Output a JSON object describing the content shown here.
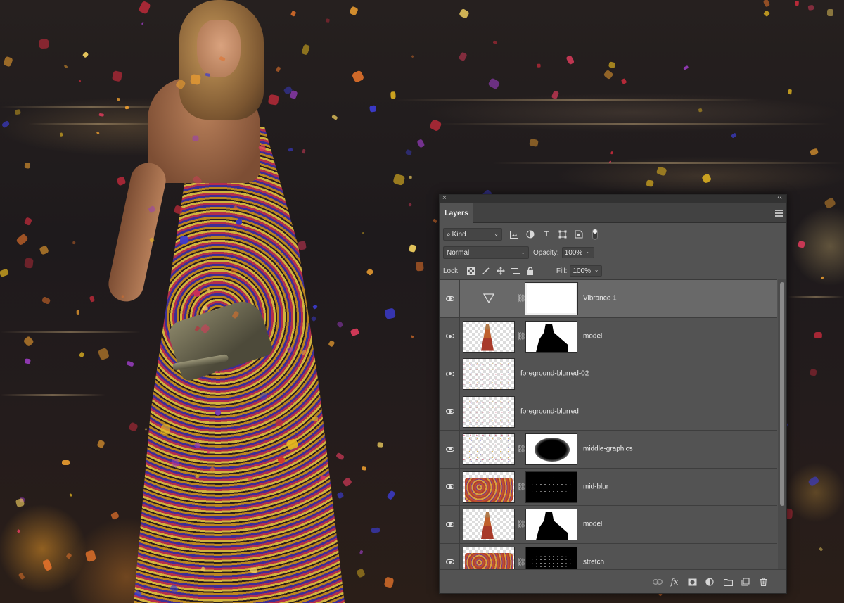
{
  "panel": {
    "close_glyph": "×",
    "collapse_glyph": "‹‹",
    "tab_label": "Layers",
    "filter": {
      "kind_label": "Kind",
      "icons": [
        "image-filter-icon",
        "adjustment-filter-icon",
        "type-filter-icon",
        "shape-filter-icon",
        "smart-object-filter-icon",
        "filter-toggle-icon"
      ]
    },
    "blend_mode": "Normal",
    "opacity_label": "Opacity:",
    "opacity_value": "100%",
    "lock_label": "Lock:",
    "lock_icons": [
      "lock-transparent-pixels-icon",
      "lock-image-pixels-icon",
      "lock-position-icon",
      "lock-artboard-icon",
      "lock-all-icon"
    ],
    "fill_label": "Fill:",
    "fill_value": "100%",
    "layers": [
      {
        "name": "Vibrance 1",
        "type": "adjustment",
        "selected": true,
        "has_mask": true,
        "linked": true
      },
      {
        "name": "model",
        "type": "pixel",
        "selected": false,
        "has_mask": true,
        "linked": true
      },
      {
        "name": "foreground-blurred-02",
        "type": "pixel",
        "selected": false,
        "has_mask": false
      },
      {
        "name": "foreground-blurred",
        "type": "pixel",
        "selected": false,
        "has_mask": false
      },
      {
        "name": "middle-graphics",
        "type": "pixel",
        "selected": false,
        "has_mask": true,
        "linked": true
      },
      {
        "name": "mid-blur",
        "type": "pixel",
        "selected": false,
        "has_mask": true,
        "linked": true
      },
      {
        "name": "model",
        "type": "pixel",
        "selected": false,
        "has_mask": true,
        "linked": true
      },
      {
        "name": "stretch",
        "type": "pixel",
        "selected": false,
        "has_mask": true,
        "linked": true
      }
    ],
    "footer_icons": [
      "link-layers-icon",
      "fx-icon",
      "add-mask-icon",
      "new-adjustment-layer-icon",
      "new-group-icon",
      "new-layer-icon",
      "delete-layer-icon"
    ],
    "fx_label": "fx"
  },
  "colors": {
    "panel_bg": "#535353",
    "selected_row": "#696969",
    "titlebar": "#323232"
  }
}
